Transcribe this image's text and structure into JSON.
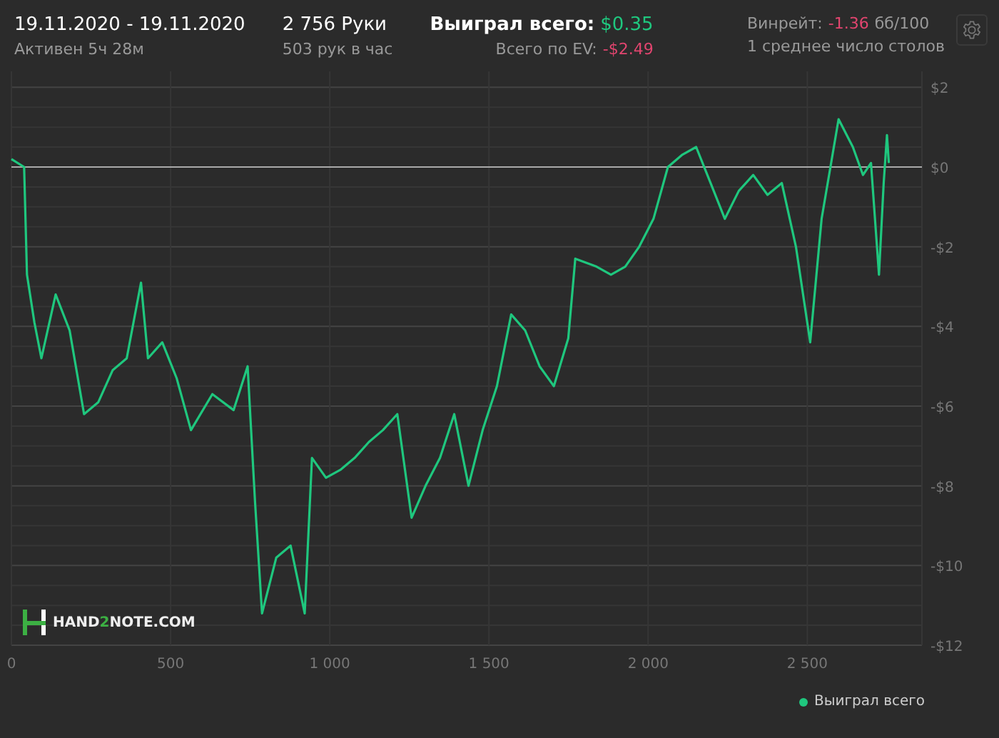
{
  "header": {
    "period": "19.11.2020 - 19.11.2020",
    "active": "Активен 5ч 28м",
    "hands": "2 756 Руки",
    "hands_per_hour": "503 рук в час",
    "won_label": "Выиграл всего:",
    "won_value": "$0.35",
    "ev_label": "Всего по EV:",
    "ev_value": "-$2.49",
    "winrate_label": "Винрейт:",
    "winrate_value": "-1.36",
    "winrate_unit": "бб/100",
    "tables": "1 среднее число столов"
  },
  "watermark": {
    "parts": [
      "HAND",
      "2",
      "NOTE.COM"
    ]
  },
  "chart": {
    "chart_data": {
      "type": "line",
      "grid": true,
      "xlim": [
        0,
        2860
      ],
      "ylim": [
        -12,
        2.4
      ],
      "xticks": [
        {
          "value": 0,
          "label": "0"
        },
        {
          "value": 500,
          "label": "500"
        },
        {
          "value": 1000,
          "label": "1 000"
        },
        {
          "value": 1500,
          "label": "1 500"
        },
        {
          "value": 2000,
          "label": "2 000"
        },
        {
          "value": 2500,
          "label": "2 500"
        }
      ],
      "yticks": [
        {
          "value": 2,
          "label": "$2"
        },
        {
          "value": 0,
          "label": "$0"
        },
        {
          "value": -2,
          "label": "-$2"
        },
        {
          "value": -4,
          "label": "-$4"
        },
        {
          "value": -6,
          "label": "-$6"
        },
        {
          "value": -8,
          "label": "-$8"
        },
        {
          "value": -10,
          "label": "-$10"
        },
        {
          "value": -12,
          "label": "-$12"
        }
      ],
      "x": [
        0,
        40,
        49,
        72,
        94,
        139,
        183,
        228,
        273,
        318,
        362,
        407,
        429,
        474,
        519,
        564,
        631,
        698,
        742,
        765,
        787,
        832,
        877,
        921,
        944,
        988,
        1033,
        1078,
        1123,
        1167,
        1212,
        1257,
        1301,
        1346,
        1391,
        1436,
        1480,
        1525,
        1570,
        1614,
        1659,
        1704,
        1749,
        1771,
        1838,
        1883,
        1928,
        1972,
        2017,
        2062,
        2106,
        2151,
        2196,
        2241,
        2285,
        2330,
        2375,
        2420,
        2464,
        2509,
        2545,
        2598,
        2643,
        2675,
        2700,
        2725,
        2740,
        2750,
        2756
      ],
      "series": [
        {
          "name": "Выиграл всего",
          "color": "#1fc77e",
          "values": [
            0.2,
            0,
            -2.7,
            -3.9,
            -4.8,
            -3.2,
            -4.1,
            -6.2,
            -5.9,
            -5.1,
            -4.8,
            -2.9,
            -4.8,
            -4.4,
            -5.3,
            -6.6,
            -5.7,
            -6.1,
            -5,
            -8.4,
            -11.2,
            -9.8,
            -9.5,
            -11.2,
            -7.3,
            -7.8,
            -7.6,
            -7.3,
            -6.9,
            -6.6,
            -6.2,
            -8.8,
            -8,
            -7.3,
            -6.2,
            -8,
            -6.6,
            -5.5,
            -3.7,
            -4.1,
            -5,
            -5.5,
            -4.3,
            -2.3,
            -2.5,
            -2.7,
            -2.5,
            -2,
            -1.3,
            0,
            0.3,
            0.5,
            -0.4,
            -1.3,
            -0.6,
            -0.2,
            -0.7,
            -0.4,
            -2,
            -4.4,
            -1.3,
            1.2,
            0.5,
            -0.2,
            0.1,
            -2.7,
            -0.4,
            0.8,
            0.1
          ]
        }
      ]
    }
  }
}
